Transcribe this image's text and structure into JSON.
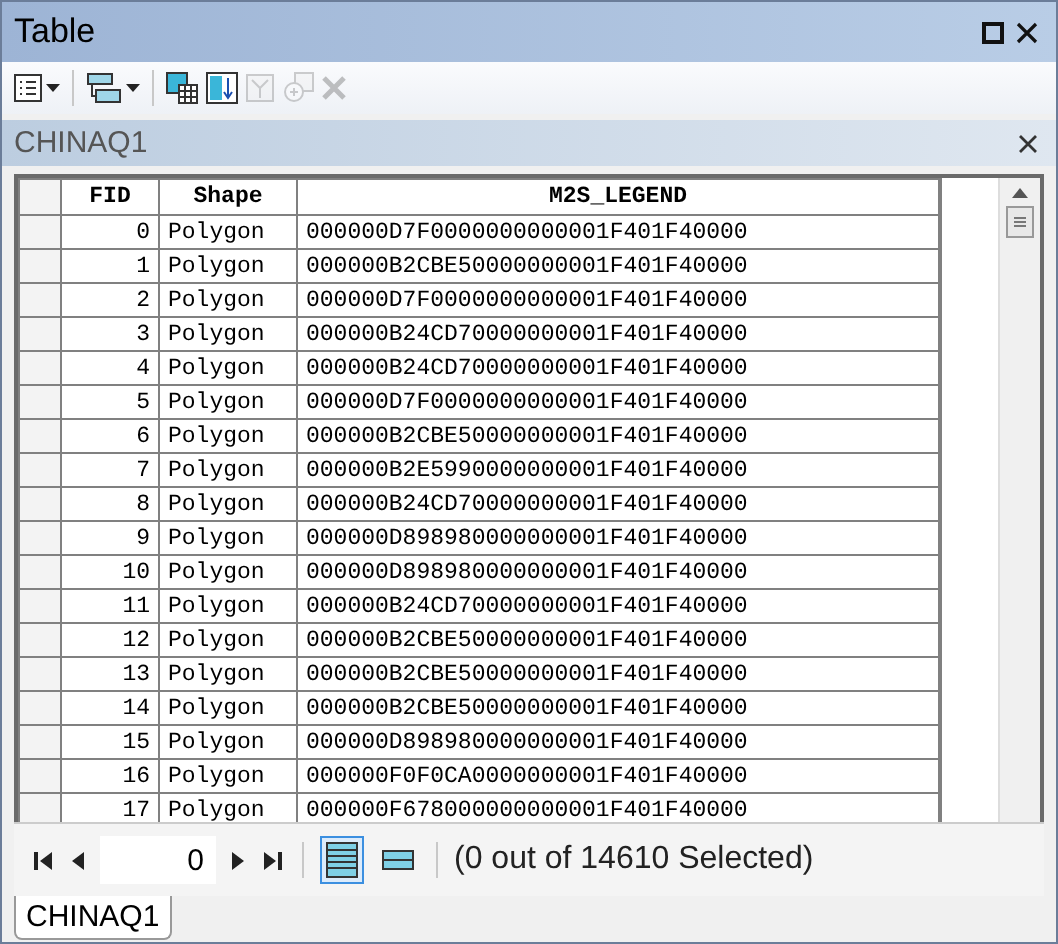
{
  "window": {
    "title": "Table"
  },
  "toolbar": [
    {
      "kind": "options",
      "disabled": false
    },
    {
      "kind": "related",
      "disabled": false
    },
    {
      "kind": "select-attr",
      "disabled": false
    },
    {
      "kind": "switch",
      "disabled": false
    },
    {
      "kind": "clear",
      "disabled": true
    },
    {
      "kind": "zoom",
      "disabled": true
    },
    {
      "kind": "delete",
      "disabled": true
    }
  ],
  "table_title": "CHINAQ1",
  "table": {
    "columns": [
      "FID",
      "Shape",
      "M2S_LEGEND"
    ],
    "rows": [
      [
        "0",
        "Polygon",
        "000000D7F0000000000001F401F40000"
      ],
      [
        "1",
        "Polygon",
        "000000B2CBE50000000001F401F40000"
      ],
      [
        "2",
        "Polygon",
        "000000D7F0000000000001F401F40000"
      ],
      [
        "3",
        "Polygon",
        "000000B24CD70000000001F401F40000"
      ],
      [
        "4",
        "Polygon",
        "000000B24CD70000000001F401F40000"
      ],
      [
        "5",
        "Polygon",
        "000000D7F0000000000001F401F40000"
      ],
      [
        "6",
        "Polygon",
        "000000B2CBE50000000001F401F40000"
      ],
      [
        "7",
        "Polygon",
        "000000B2E5990000000001F401F40000"
      ],
      [
        "8",
        "Polygon",
        "000000B24CD70000000001F401F40000"
      ],
      [
        "9",
        "Polygon",
        "000000D898980000000001F401F40000"
      ],
      [
        "10",
        "Polygon",
        "000000D898980000000001F401F40000"
      ],
      [
        "11",
        "Polygon",
        "000000B24CD70000000001F401F40000"
      ],
      [
        "12",
        "Polygon",
        "000000B2CBE50000000001F401F40000"
      ],
      [
        "13",
        "Polygon",
        "000000B2CBE50000000001F401F40000"
      ],
      [
        "14",
        "Polygon",
        "000000B2CBE50000000001F401F40000"
      ],
      [
        "15",
        "Polygon",
        "000000D898980000000001F401F40000"
      ],
      [
        "16",
        "Polygon",
        "000000F0F0CA0000000001F401F40000"
      ],
      [
        "17",
        "Polygon",
        "000000F678000000000001F401F40000"
      ]
    ]
  },
  "navigator": {
    "record": "0",
    "views": [
      {
        "kind": "all",
        "selected": true
      },
      {
        "kind": "selected",
        "selected": false
      }
    ],
    "status": "(0 out of 14610 Selected)"
  },
  "tabs": [
    {
      "label": "CHINAQ1",
      "selected": true
    }
  ]
}
